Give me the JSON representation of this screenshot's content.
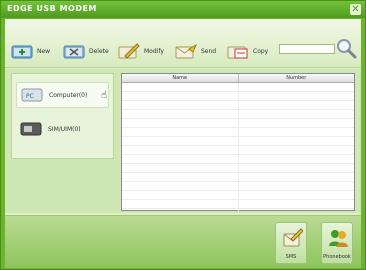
{
  "window": {
    "title": "EDGE USB MODEM"
  },
  "toolbar": {
    "new_label": "New",
    "delete_label": "Delete",
    "modify_label": "Modify",
    "send_label": "Send",
    "copy_label": "Copy",
    "search_value": ""
  },
  "sidebar": {
    "items": [
      {
        "label": "Computer(0)",
        "icon": "computer-icon",
        "selected": true
      },
      {
        "label": "SIM/UIM(0)",
        "icon": "sim-card-icon",
        "selected": false
      }
    ]
  },
  "table": {
    "columns": [
      "Name",
      "Number"
    ],
    "rows": []
  },
  "bottom": {
    "sms_label": "SMS",
    "phonebook_label": "Phonebook"
  },
  "colors": {
    "accent": "#6cb32e",
    "panel": "#dff0c8"
  }
}
